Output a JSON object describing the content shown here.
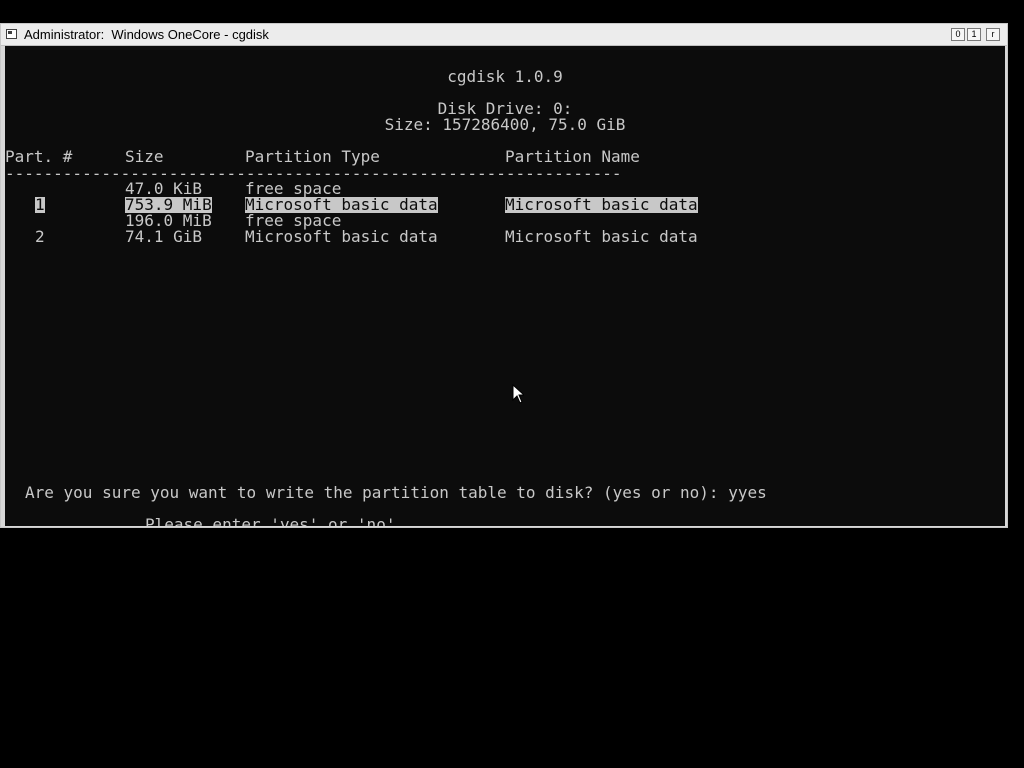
{
  "window": {
    "title": "Administrator:  Windows OneCore - cgdisk",
    "buttons": {
      "minimize": "0",
      "maximize": "1",
      "close": "r"
    }
  },
  "console": {
    "app_title": "cgdisk 1.0.9",
    "disk_drive": "Disk Drive: 0:",
    "disk_size": "Size: 157286400, 75.0 GiB",
    "headers": {
      "part": "Part. #",
      "size": "Size",
      "type": "Partition Type",
      "name": "Partition Name"
    },
    "divider": "----------------------------------------------------------------",
    "rows": [
      {
        "part": "",
        "size": "47.0 KiB",
        "type": "free space",
        "name": "",
        "selected": false
      },
      {
        "part": "1",
        "size": "753.9 MiB",
        "type": "Microsoft basic data",
        "name": "Microsoft basic data",
        "selected": true
      },
      {
        "part": "",
        "size": "196.0 MiB",
        "type": "free space",
        "name": "",
        "selected": false
      },
      {
        "part": "2",
        "size": "74.1 GiB",
        "type": "Microsoft basic data",
        "name": "Microsoft basic data",
        "selected": false
      }
    ],
    "prompt": "Are you sure you want to write the partition table to disk? (yes or no): yyes",
    "message": "Please enter 'yes' or 'no'"
  },
  "colors": {
    "console_bg": "#0c0c0c",
    "console_fg": "#c8c8c8",
    "desktop_bg": "#000000",
    "titlebar_bg": "#ececec"
  }
}
